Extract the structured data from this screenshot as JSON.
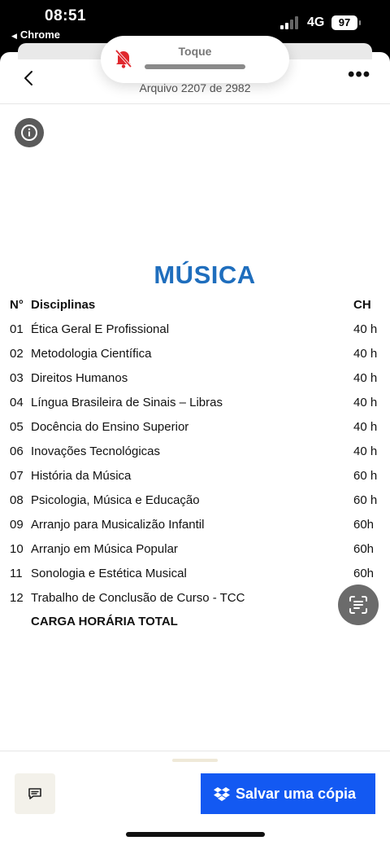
{
  "status": {
    "time": "08:51",
    "back_app": "Chrome",
    "network": "4G",
    "battery": "97"
  },
  "notification": {
    "title": "Toque",
    "icon": "bell-slash-icon"
  },
  "viewer": {
    "file_counter": "Arquivo 2207 de 2982",
    "back_icon": "chevron-left-icon",
    "more_icon": "more-horizontal-icon",
    "info_icon": "info-icon",
    "scan_icon": "text-scan-icon"
  },
  "document": {
    "title": "MÚSICA",
    "header": {
      "num": "N°",
      "name": "Disciplinas",
      "ch": "CH"
    },
    "rows": [
      {
        "num": "01",
        "name": "Ética Geral E Profissional",
        "ch": "40 h"
      },
      {
        "num": "02",
        "name": "Metodologia Científica",
        "ch": "40 h"
      },
      {
        "num": "03",
        "name": "Direitos Humanos",
        "ch": "40 h"
      },
      {
        "num": "04",
        "name": "Língua Brasileira de Sinais – Libras",
        "ch": "40 h"
      },
      {
        "num": "05",
        "name": "Docência do Ensino Superior",
        "ch": "40 h"
      },
      {
        "num": "06",
        "name": "Inovações Tecnológicas",
        "ch": "40 h"
      },
      {
        "num": "07",
        "name": "História da Música",
        "ch": "60 h"
      },
      {
        "num": "08",
        "name": "Psicologia, Música e Educação",
        "ch": "60 h"
      },
      {
        "num": "09",
        "name": "Arranjo para Musicalizão Infantil",
        "ch": "60h"
      },
      {
        "num": "10",
        "name": "Arranjo em Música Popular",
        "ch": "60h"
      },
      {
        "num": "11",
        "name": "Sonologia e Estética Musical",
        "ch": "60h"
      },
      {
        "num": "12",
        "name": "Trabalho de Conclusão de Curso - TCC",
        "ch": ""
      }
    ],
    "total": {
      "label": "CARGA HORÁRIA TOTAL",
      "ch": ""
    }
  },
  "footer": {
    "save_label": "Salvar uma cópia",
    "save_icon": "dropbox-icon",
    "comment_icon": "comment-icon"
  },
  "colors": {
    "title_blue": "#1f6ebd",
    "primary_button": "#1359f2",
    "notification_icon": "#e0282e"
  }
}
